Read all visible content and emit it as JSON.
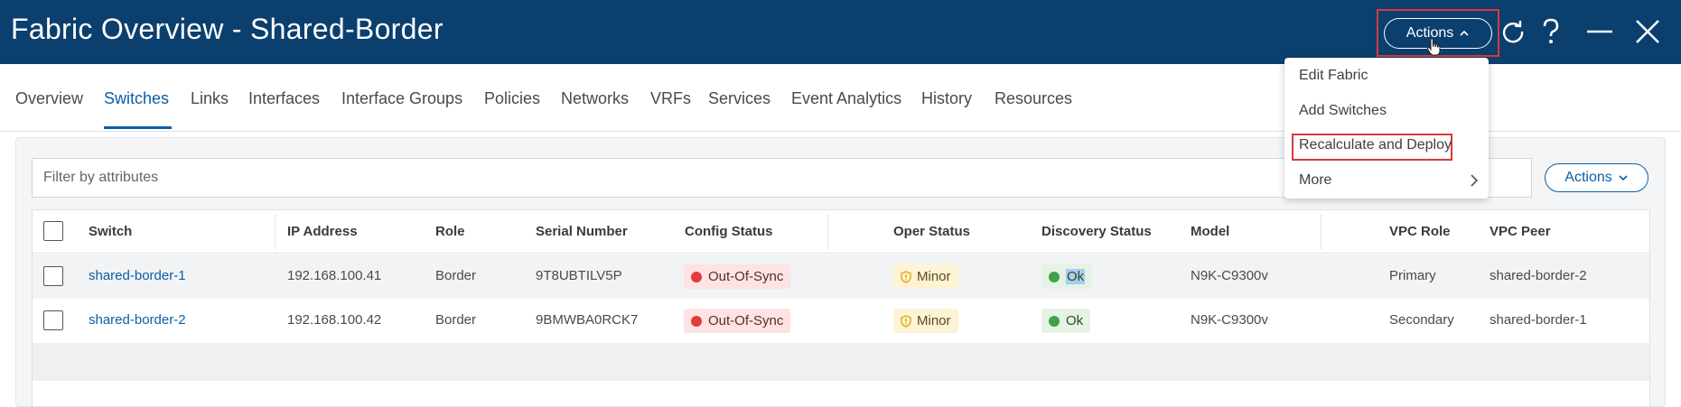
{
  "header": {
    "title": "Fabric Overview - Shared-Border",
    "actions_label": "Actions",
    "icons": [
      "refresh-icon",
      "help-icon",
      "minimize-icon",
      "close-icon"
    ]
  },
  "tabs": [
    {
      "label": "Overview",
      "active": false
    },
    {
      "label": "Switches",
      "active": true
    },
    {
      "label": "Links",
      "active": false
    },
    {
      "label": "Interfaces",
      "active": false
    },
    {
      "label": "Interface Groups",
      "active": false
    },
    {
      "label": "Policies",
      "active": false
    },
    {
      "label": "Networks",
      "active": false
    },
    {
      "label": "VRFs",
      "active": false
    },
    {
      "label": "Services",
      "active": false
    },
    {
      "label": "Event Analytics",
      "active": false
    },
    {
      "label": "History",
      "active": false
    },
    {
      "label": "Resources",
      "active": false
    }
  ],
  "menu": {
    "items": [
      "Edit Fabric",
      "Add Switches",
      "Recalculate and Deploy",
      "More"
    ]
  },
  "filter": {
    "placeholder": "Filter by attributes"
  },
  "table_actions_label": "Actions",
  "table": {
    "columns": [
      "Switch",
      "IP Address",
      "Role",
      "Serial Number",
      "Config Status",
      "Oper Status",
      "Discovery Status",
      "Model",
      "VPC Role",
      "VPC Peer"
    ],
    "rows": [
      {
        "switch": "shared-border-1",
        "ip": "192.168.100.41",
        "role": "Border",
        "serial": "9T8UBTILV5P",
        "config_status": "Out-Of-Sync",
        "oper_status": "Minor",
        "discovery_status": "Ok",
        "model": "N9K-C9300v",
        "vpc_role": "Primary",
        "vpc_peer": "shared-border-2"
      },
      {
        "switch": "shared-border-2",
        "ip": "192.168.100.42",
        "role": "Border",
        "serial": "9BMWBA0RCK7",
        "config_status": "Out-Of-Sync",
        "oper_status": "Minor",
        "discovery_status": "Ok",
        "model": "N9K-C9300v",
        "vpc_role": "Secondary",
        "vpc_peer": "shared-border-1"
      }
    ]
  },
  "colors": {
    "header_bg": "#0b3f6e",
    "accent": "#0b5fa5",
    "highlight_box": "#d93a3a",
    "status_red": "#e23b3b",
    "status_green": "#43a047",
    "status_minor": "#e0b020"
  }
}
